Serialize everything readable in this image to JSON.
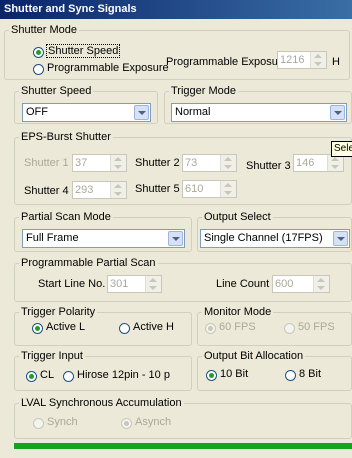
{
  "title": "Shutter and Sync Signals",
  "title_mark": "",
  "shutter_mode": {
    "legend": "Shutter Mode",
    "option_speed": "Shutter Speed",
    "option_prog": "Programmable Exposure",
    "selected": "Shutter Speed",
    "exposure_label": "Programmable Exposure",
    "exposure_value": "1216",
    "exposure_unit": "H"
  },
  "shutter_speed": {
    "legend": "Shutter Speed",
    "value": "OFF"
  },
  "trigger_mode": {
    "legend": "Trigger Mode",
    "value": "Normal"
  },
  "eps_burst": {
    "legend": "EPS-Burst Shutter",
    "s1_label": "Shutter 1",
    "s1_value": "37",
    "s2_label": "Shutter 2",
    "s2_value": "73",
    "s3_label": "Shutter 3",
    "s3_value": "146",
    "s4_label": "Shutter 4",
    "s4_value": "293",
    "s5_label": "Shutter 5",
    "s5_value": "610"
  },
  "tooltip": "Sele",
  "partial_scan": {
    "legend": "Partial Scan Mode",
    "value": "Full Frame"
  },
  "output_select": {
    "legend": "Output Select",
    "value": "Single Channel (17FPS)"
  },
  "prog_partial": {
    "legend": "Programmable Partial Scan",
    "start_label": "Start Line No.",
    "start_value": "301",
    "count_label": "Line Count",
    "count_value": "600"
  },
  "trigger_polarity": {
    "legend": "Trigger Polarity",
    "opt_low": "Active L",
    "opt_high": "Active H",
    "selected": "Active L"
  },
  "monitor_mode": {
    "legend": "Monitor Mode",
    "opt_60": "60 FPS",
    "opt_50": "50 FPS",
    "selected": "60 FPS"
  },
  "trigger_input": {
    "legend": "Trigger Input",
    "opt_cl": "CL",
    "opt_hirose": "Hirose 12pin - 10 p",
    "selected": "CL"
  },
  "output_bit": {
    "legend": "Output Bit Allocation",
    "opt_10": "10 Bit",
    "opt_8": "8 Bit",
    "selected": "10 Bit"
  },
  "lval": {
    "legend": "LVAL Synchronous Accumulation",
    "opt_synch": "Synch",
    "opt_asynch": "Asynch",
    "selected": "Asynch"
  },
  "colors": {
    "title_start": "#0a246a",
    "title_end": "#3a6ea5",
    "panel": "#ece9d8",
    "status_bar": "#15a21d"
  }
}
